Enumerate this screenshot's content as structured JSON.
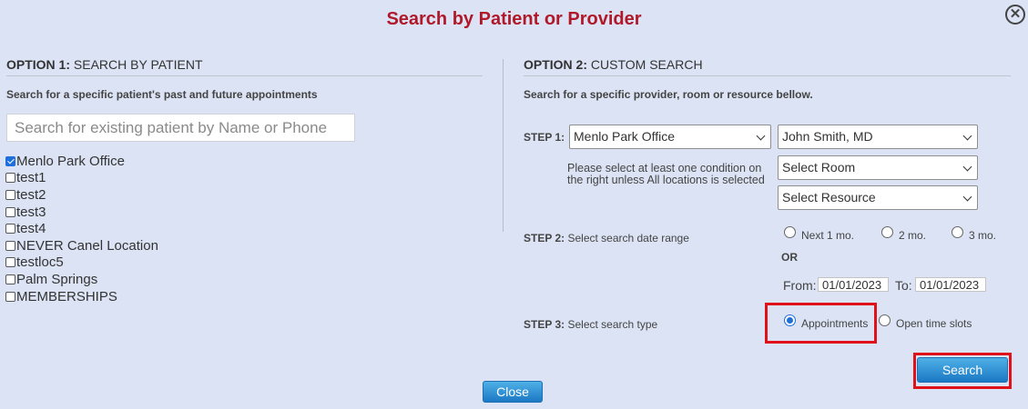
{
  "dialog": {
    "title": "Search by Patient or Provider",
    "close_icon": "close-circle-icon",
    "close_glyph": "✕"
  },
  "option1": {
    "heading_bold": "OPTION 1:",
    "heading_text": " SEARCH BY PATIENT",
    "description": "Search for a specific patient's past and future appointments",
    "search_placeholder": "Search for existing patient by Name or Phone",
    "locations": [
      {
        "label": "Menlo Park Office",
        "checked": true
      },
      {
        "label": "test1",
        "checked": false
      },
      {
        "label": "test2",
        "checked": false
      },
      {
        "label": "test3",
        "checked": false
      },
      {
        "label": "test4",
        "checked": false
      },
      {
        "label": "NEVER Canel Location",
        "checked": false
      },
      {
        "label": "testloc5",
        "checked": false
      },
      {
        "label": "Palm Springs",
        "checked": false
      },
      {
        "label": "MEMBERSHIPS",
        "checked": false
      }
    ]
  },
  "option2": {
    "heading_bold": "OPTION 2:",
    "heading_text": " CUSTOM SEARCH",
    "description": "Search for a specific provider, room or resource bellow.",
    "step1": {
      "label_bold": "STEP 1:",
      "location_select": "Menlo Park Office",
      "provider_select": "John Smith, MD",
      "room_select": "Select Room",
      "resource_select": "Select Resource",
      "note": "Please select at least one condition on the right unless All locations is selected"
    },
    "step2": {
      "label_bold": "STEP 2:",
      "label_text": " Select search date range",
      "ranges": [
        "Next 1 mo.",
        "2 mo.",
        "3 mo."
      ],
      "or_text": "OR",
      "from_label": "From:",
      "from_value": "01/01/2023",
      "to_label": "To:",
      "to_value": "01/01/2023"
    },
    "step3": {
      "label_bold": "STEP 3:",
      "label_text": " Select search type",
      "types": [
        {
          "label": "Appointments",
          "selected": true
        },
        {
          "label": "Open time slots",
          "selected": false
        }
      ]
    },
    "search_button": "Search"
  },
  "footer": {
    "close_button": "Close"
  },
  "colors": {
    "title": "#b0192a",
    "highlight": "#e1111a",
    "background": "#dbe3f4",
    "button": "#1b78c4"
  }
}
